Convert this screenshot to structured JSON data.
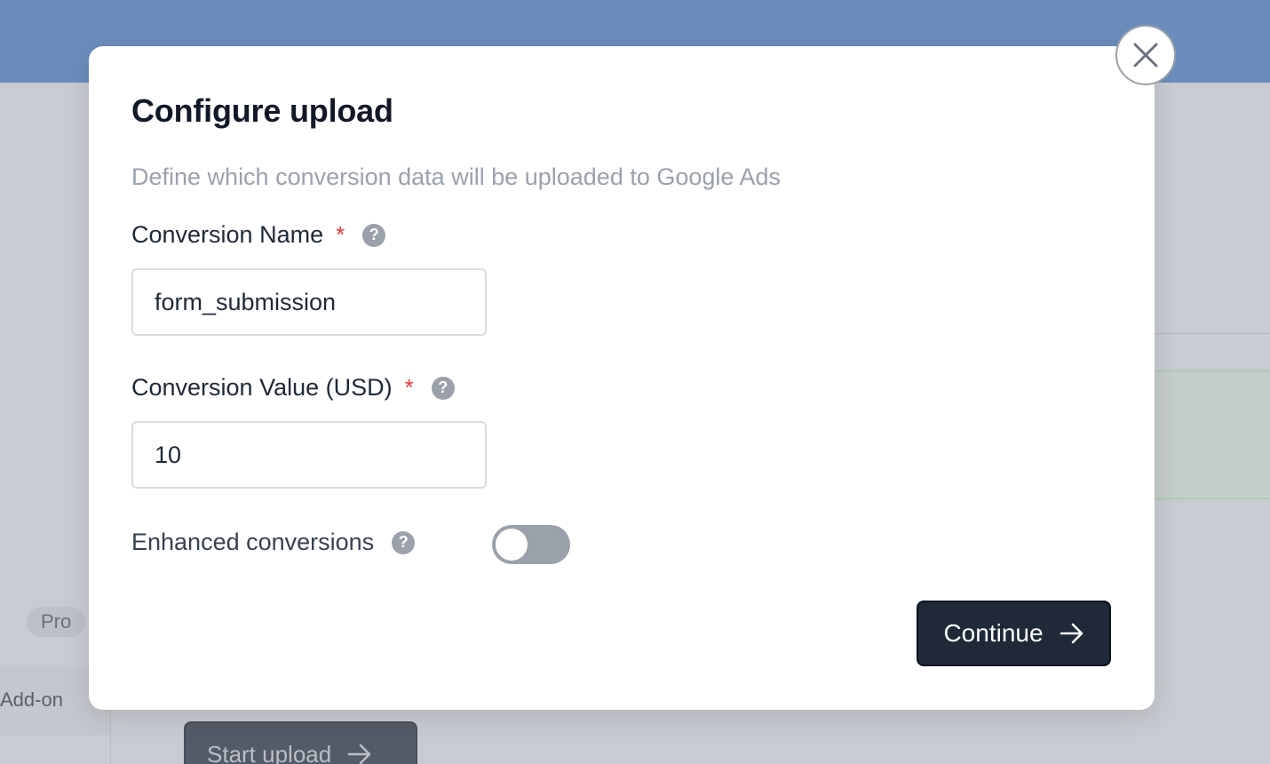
{
  "background": {
    "badge_pro": "Pro",
    "addon_label": "Add-on",
    "start_upload_label": "Start upload"
  },
  "modal": {
    "title": "Configure upload",
    "subtitle": "Define which conversion data will be uploaded to Google Ads",
    "fields": {
      "conversion_name": {
        "label": "Conversion Name",
        "required_mark": "*",
        "value": "form_submission"
      },
      "conversion_value": {
        "label": "Conversion Value (USD)",
        "required_mark": "*",
        "value": "10"
      }
    },
    "enhanced_conversions": {
      "label": "Enhanced conversions",
      "enabled": false
    },
    "help_glyph": "?",
    "continue_label": "Continue"
  },
  "colors": {
    "header_blue": "#6a8dbc",
    "primary_button": "#1f2937",
    "required_red": "#e23b3b",
    "toggle_off": "#9ba1aa"
  },
  "icons": {
    "close": "close-icon",
    "help": "help-icon",
    "continue_arrow": "arrow-right-icon"
  }
}
